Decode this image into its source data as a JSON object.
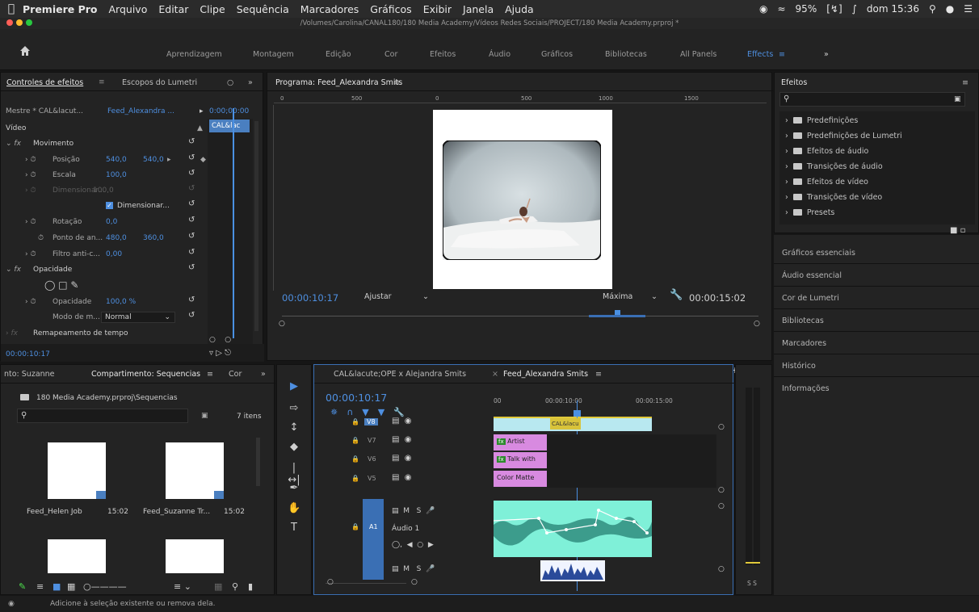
{
  "menubar": {
    "app": "Premiere Pro",
    "items": [
      "Arquivo",
      "Editar",
      "Clipe",
      "Sequência",
      "Marcadores",
      "Gráficos",
      "Exibir",
      "Janela",
      "Ajuda"
    ],
    "battery": "95%",
    "clock": "dom 15:36"
  },
  "window": {
    "path": "/Volumes/Carolina/CANAL180/180 Media Academy/Vídeos Redes Sociais/PROJECT/180 Media Academy.prproj *"
  },
  "workspaces": [
    "Aprendizagem",
    "Montagem",
    "Edição",
    "Cor",
    "Efeitos",
    "Áudio",
    "Gráficos",
    "Bibliotecas",
    "All Panels",
    "Effects"
  ],
  "effect_controls": {
    "tab_active": "Controles de efeitos",
    "tab_other": "Escopos do Lumetri",
    "master": "Mestre * CAL&lacut...",
    "sequence": "Feed_Alexandra ...",
    "time_ruler": "0:00;00:00",
    "clip_label": "CAL&lac",
    "section_video": "Vídeo",
    "motion": "Movimento",
    "position_label": "Posição",
    "position_x": "540,0",
    "position_y": "540,0",
    "scale_label": "Escala",
    "scale": "100,0",
    "scale_width_label": "Dimensionar...",
    "scale_width": "100,0",
    "uniform": "Dimensionar...",
    "rotation_label": "Rotação",
    "rotation": "0,0",
    "anchor_label": "Ponto de an...",
    "anchor_x": "480,0",
    "anchor_y": "360,0",
    "flicker_label": "Filtro anti-c...",
    "flicker": "0,00",
    "opacity_section": "Opacidade",
    "opacity_label": "Opacidade",
    "opacity": "100,0 %",
    "blend_label": "Modo de m...",
    "blend": "Normal",
    "time_remap": "Remapeamento de tempo",
    "timecode": "00:00:10:17"
  },
  "program": {
    "title": "Programa: Feed_Alexandra Smits",
    "ruler": [
      "0",
      "500",
      "0",
      "500",
      "1000",
      "1500"
    ],
    "timecode": "00:00:10:17",
    "fit": "Ajustar",
    "quality": "Máxima",
    "duration": "00:00:15:02"
  },
  "project": {
    "tab1": "nto: Suzanne",
    "tab2": "Compartimento: Sequencias",
    "tab3": "Cor",
    "path": "180 Media Academy.prproj\\Sequencias",
    "count": "7 itens",
    "items": [
      {
        "name": "Feed_Helen Job",
        "duration": "15:02"
      },
      {
        "name": "Feed_Suzanne Tr...",
        "duration": "15:02"
      }
    ]
  },
  "timeline": {
    "tab_inactive": "CAL&lacute;OPE x Alejandra Smits",
    "tab_active": "Feed_Alexandra Smits",
    "timecode": "00:00:10:17",
    "ruler": [
      "00",
      "00:00:10:00",
      "00:00:15:00"
    ],
    "tracks": [
      "V8",
      "V7",
      "V6",
      "V5",
      "A1"
    ],
    "audio_name": "Áudio 1",
    "clips": {
      "top": "CAL&lacu",
      "artist": "Artist",
      "talk": "Talk with",
      "matte": "Color Matte"
    },
    "audio_meter": "S S"
  },
  "effects_panel": {
    "title": "Efeitos",
    "folders": [
      "Predefinições",
      "Predefinições de Lumetri",
      "Efeitos de áudio",
      "Transições de áudio",
      "Efeitos de vídeo",
      "Transições de vídeo",
      "Presets"
    ]
  },
  "right_panels": [
    "Gráficos essenciais",
    "Áudio essencial",
    "Cor de Lumetri",
    "Bibliotecas",
    "Marcadores",
    "Histórico",
    "Informações"
  ],
  "status": "Adicione à seleção existente ou remova dela.",
  "colors": {
    "accent_blue": "#4e8fe0",
    "clip_pink": "#d88ae0",
    "clip_cyan": "#7ff0d8",
    "playhead": "#4a90e2"
  }
}
